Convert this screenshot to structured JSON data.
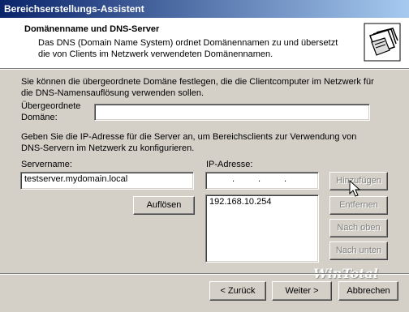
{
  "window": {
    "title": "Bereichserstellungs-Assistent"
  },
  "header": {
    "title": "Domänenname und DNS-Server",
    "description": "Das DNS (Domain Name System) ordnet Domänennamen zu und übersetzt die von Clients im Netzwerk verwendeten Domänennamen."
  },
  "domain_section": {
    "intro": "Sie können die übergeordnete Domäne festlegen, die die Clientcomputer im Netzwerk für die DNS-Namensauflösung verwenden sollen.",
    "parent_label_line1": "Übergeordnete",
    "parent_label_line2": "Domäne:",
    "parent_value": ""
  },
  "dns_section": {
    "intro": "Geben Sie die IP-Adresse für die Server an, um Bereichsclients zur Verwendung von DNS-Servern im Netzwerk zu konfigurieren.",
    "server_label": "Servername:",
    "server_value": "testserver.mydomain.local",
    "ip_label": "IP-Adresse:",
    "resolve_button": "Auflösen",
    "ip_list": [
      "192.168.10.254"
    ],
    "add_button": "Hinzufügen",
    "remove_button": "Entfernen",
    "up_button": "Nach oben",
    "down_button": "Nach unten"
  },
  "footer": {
    "back_button": "< Zurück",
    "next_button": "Weiter >",
    "cancel_button": "Abbrechen"
  },
  "watermark": "WinTotal",
  "colors": {
    "titlebar_start": "#0a246a",
    "titlebar_end": "#a6caf0",
    "face": "#d4d0c8"
  }
}
